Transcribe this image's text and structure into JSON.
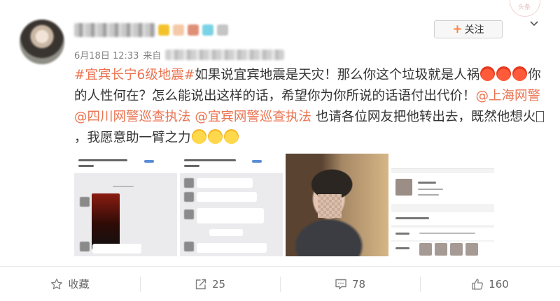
{
  "post": {
    "date": "6月18日 12:33",
    "source_prefix": "来自",
    "follow_label": "关注",
    "stamp_text": "头条",
    "content": {
      "topic": "#宜宾长宁6级地震#",
      "text1": "如果说宜宾地震是天灾！那么你这个垃圾就是人祸",
      "text2": "你的人性何在？怎么能说出这样的话，希望你为你所说的话语付出代价！",
      "mention1": "@上海网警",
      "mention2": "@四川网警巡查执法",
      "mention3": "@宜宾网警巡查执法",
      "text3": "也请各位网友把他转出去，既然他想火",
      "text4": "，我愿意助一臂之力"
    }
  },
  "actions": {
    "favorite_label": "收藏",
    "repost_count": "25",
    "comment_count": "78",
    "like_count": "160"
  },
  "icons": {
    "favorite": "star-icon",
    "repost": "repost-icon",
    "comment": "comment-icon",
    "like": "thumbs-up-icon",
    "more": "chevron-down-icon"
  },
  "colors": {
    "link": "#eb7350",
    "follow_plus": "#ff8140",
    "meta_text": "#808080"
  }
}
